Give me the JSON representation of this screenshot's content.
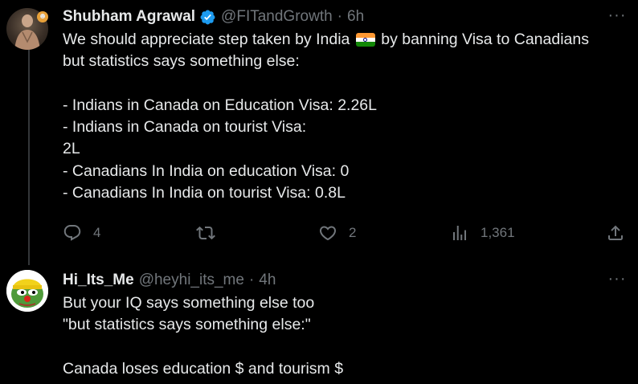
{
  "tweets": [
    {
      "author_name": "Shubham Agrawal",
      "handle": "@FITandGrowth",
      "separator": "·",
      "time": "6h",
      "text_line1_before_flag": "We should appreciate step taken by India",
      "text_line1_after_flag": "by banning Visa to Canadians",
      "text_rest": "but statistics says something else:\n\n- Indians in Canada on Education Visa: 2.26L\n- Indians in Canada on tourist Visa:\n2L\n- Canadians In India on education Visa: 0\n- Canadians In India on tourist Visa: 0.8L",
      "actions": {
        "replies": "4",
        "reposts": "",
        "likes": "2",
        "views": "1,361"
      }
    },
    {
      "author_name": "Hi_Its_Me",
      "handle": "@heyhi_its_me",
      "separator": "·",
      "time": "4h",
      "text": "But your IQ says something  else too\n\"but statistics says something else:\"\n\nCanada loses education $ and tourism $"
    }
  ],
  "icons": {
    "verified_badge": "verified-badge-icon",
    "more": "more-icon",
    "reply": "reply-icon",
    "repost": "repost-icon",
    "like": "like-icon",
    "views": "views-icon",
    "share": "share-icon",
    "flag": "india-flag-icon"
  },
  "colors": {
    "background": "#000000",
    "text": "#e7e9ea",
    "muted": "#71767b",
    "verified": "#1d9bf0",
    "thread_line": "#333639"
  }
}
